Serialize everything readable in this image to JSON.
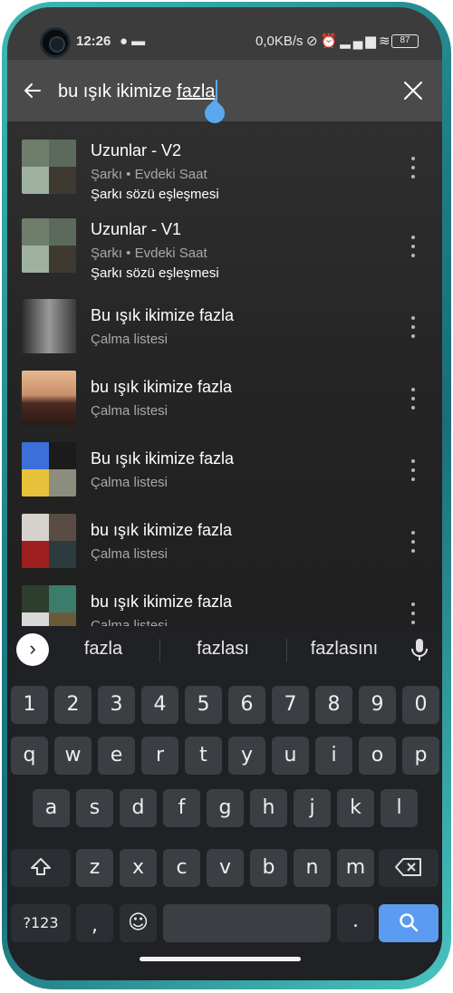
{
  "status_bar": {
    "time": "12:26",
    "left_icons": [
      "spotify-icon",
      "message-icon"
    ],
    "network_speed": "0,0KB/s",
    "right_icons": [
      "mute-icon",
      "alarm-icon",
      "hd-signal-icon",
      "wifi-icon"
    ],
    "battery": "87"
  },
  "search": {
    "query_prefix": "bu ışık ikimize ",
    "query_underlined": "fazla"
  },
  "results": [
    {
      "title": "Uzunlar - V2",
      "subtitle": "Şarkı • Evdeki Saat",
      "match": "Şarkı sözü eşleşmesi",
      "thumb": "uzunlar-cover"
    },
    {
      "title": "Uzunlar - V1",
      "subtitle": "Şarkı • Evdeki Saat",
      "match": "Şarkı sözü eşleşmesi",
      "thumb": "uzunlar-cover"
    },
    {
      "title": "Bu ışık ikimize fazla",
      "subtitle": "Çalma listesi",
      "thumb": "bw-couple-cover"
    },
    {
      "title": "bu ışık ikimize fazla",
      "subtitle": "Çalma listesi",
      "thumb": "window-scene-cover"
    },
    {
      "title": "Bu ışık ikimize fazla",
      "subtitle": "Çalma listesi",
      "thumb": "duman-mosaic-cover"
    },
    {
      "title": "bu ışık ikimize fazla",
      "subtitle": "Çalma listesi",
      "thumb": "bird-mosaic-cover"
    },
    {
      "title": "bu ışık ikimize fazla",
      "subtitle": "Çalma listesi",
      "thumb": "green-mosaic-cover"
    }
  ],
  "keyboard": {
    "suggestions": [
      "fazla",
      "fazlası",
      "fazlasını"
    ],
    "row_numbers": [
      "1",
      "2",
      "3",
      "4",
      "5",
      "6",
      "7",
      "8",
      "9",
      "0"
    ],
    "row_1": [
      "q",
      "w",
      "e",
      "r",
      "t",
      "y",
      "u",
      "i",
      "o",
      "p"
    ],
    "row_2": [
      "a",
      "s",
      "d",
      "f",
      "g",
      "h",
      "j",
      "k",
      "l"
    ],
    "row_3": [
      "z",
      "x",
      "c",
      "v",
      "b",
      "n",
      "m"
    ],
    "symbols_label": "?123",
    "comma": ",",
    "period": "."
  },
  "colors": {
    "accent": "#5aa9ef",
    "search_key": "#5b9bf1",
    "frame": "#2a9aa0"
  }
}
